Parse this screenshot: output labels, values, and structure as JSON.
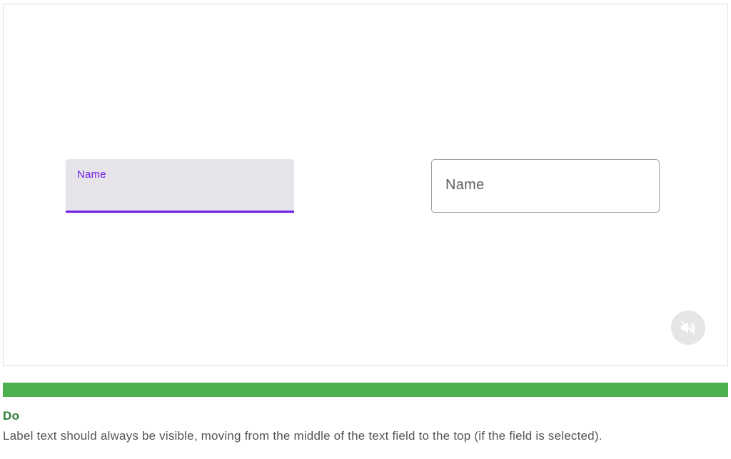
{
  "demo": {
    "filled_field": {
      "label": "Name",
      "state": "focused",
      "accent_color": "#6f1ee8",
      "fill_color": "#e7e4e9"
    },
    "outlined_field": {
      "label": "Name",
      "state": "unfocused",
      "border_color": "#9e9e9e"
    },
    "mute_button": {
      "icon": "volume-off-icon"
    }
  },
  "guideline": {
    "status_color": "#4caf50",
    "heading": "Do",
    "caption": "Label text should always be visible, moving from the middle of the text field to the top (if the field is selected)."
  }
}
